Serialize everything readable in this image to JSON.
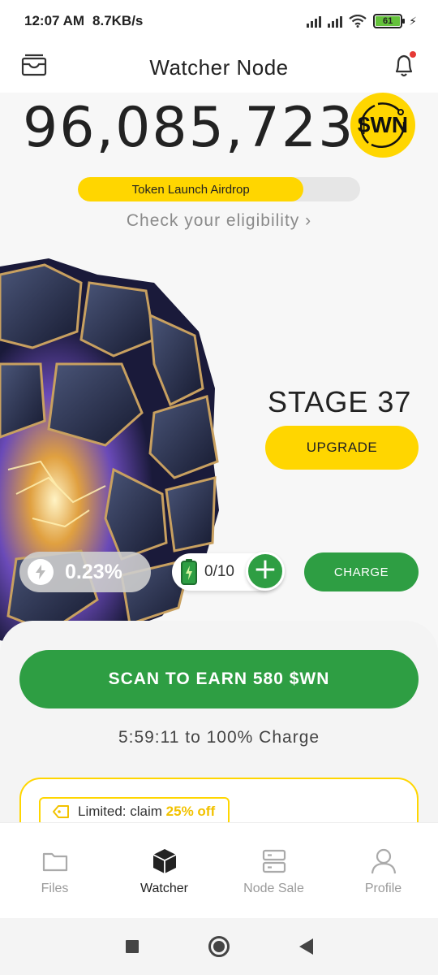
{
  "status_bar": {
    "time": "12:07 AM",
    "speed": "8.7KB/s",
    "battery": "61"
  },
  "header": {
    "title": "Watcher Node",
    "left_icon": "wallet-icon",
    "right_icon": "bell-icon"
  },
  "balance": {
    "amount": "96,085,723",
    "token": "$WN"
  },
  "airdrop": {
    "label": "Token Launch Airdrop",
    "progress_fraction": 0.8,
    "link": "Check your eligibility ›"
  },
  "stage": {
    "label": "STAGE 37",
    "upgrade": "UPGRADE"
  },
  "rate": {
    "value": "0.23%",
    "icon": "lightning-icon"
  },
  "charges": {
    "value": "0/10",
    "icon": "battery-icon",
    "add_icon": "plus-icon",
    "button": "CHARGE"
  },
  "scan": {
    "button": "SCAN TO EARN 580 $WN",
    "timer": "5:59:11 to 100% Charge"
  },
  "promo": {
    "prefix": "Limited: claim",
    "highlight": "25% off",
    "icon": "tag-icon"
  },
  "bottom_nav": {
    "items": [
      {
        "label": "Files",
        "icon": "folder-icon"
      },
      {
        "label": "Watcher",
        "icon": "cube-icon"
      },
      {
        "label": "Node Sale",
        "icon": "server-icon"
      },
      {
        "label": "Profile",
        "icon": "user-icon"
      }
    ]
  },
  "colors": {
    "accent_yellow": "#ffd600",
    "accent_green": "#2e9e43"
  }
}
